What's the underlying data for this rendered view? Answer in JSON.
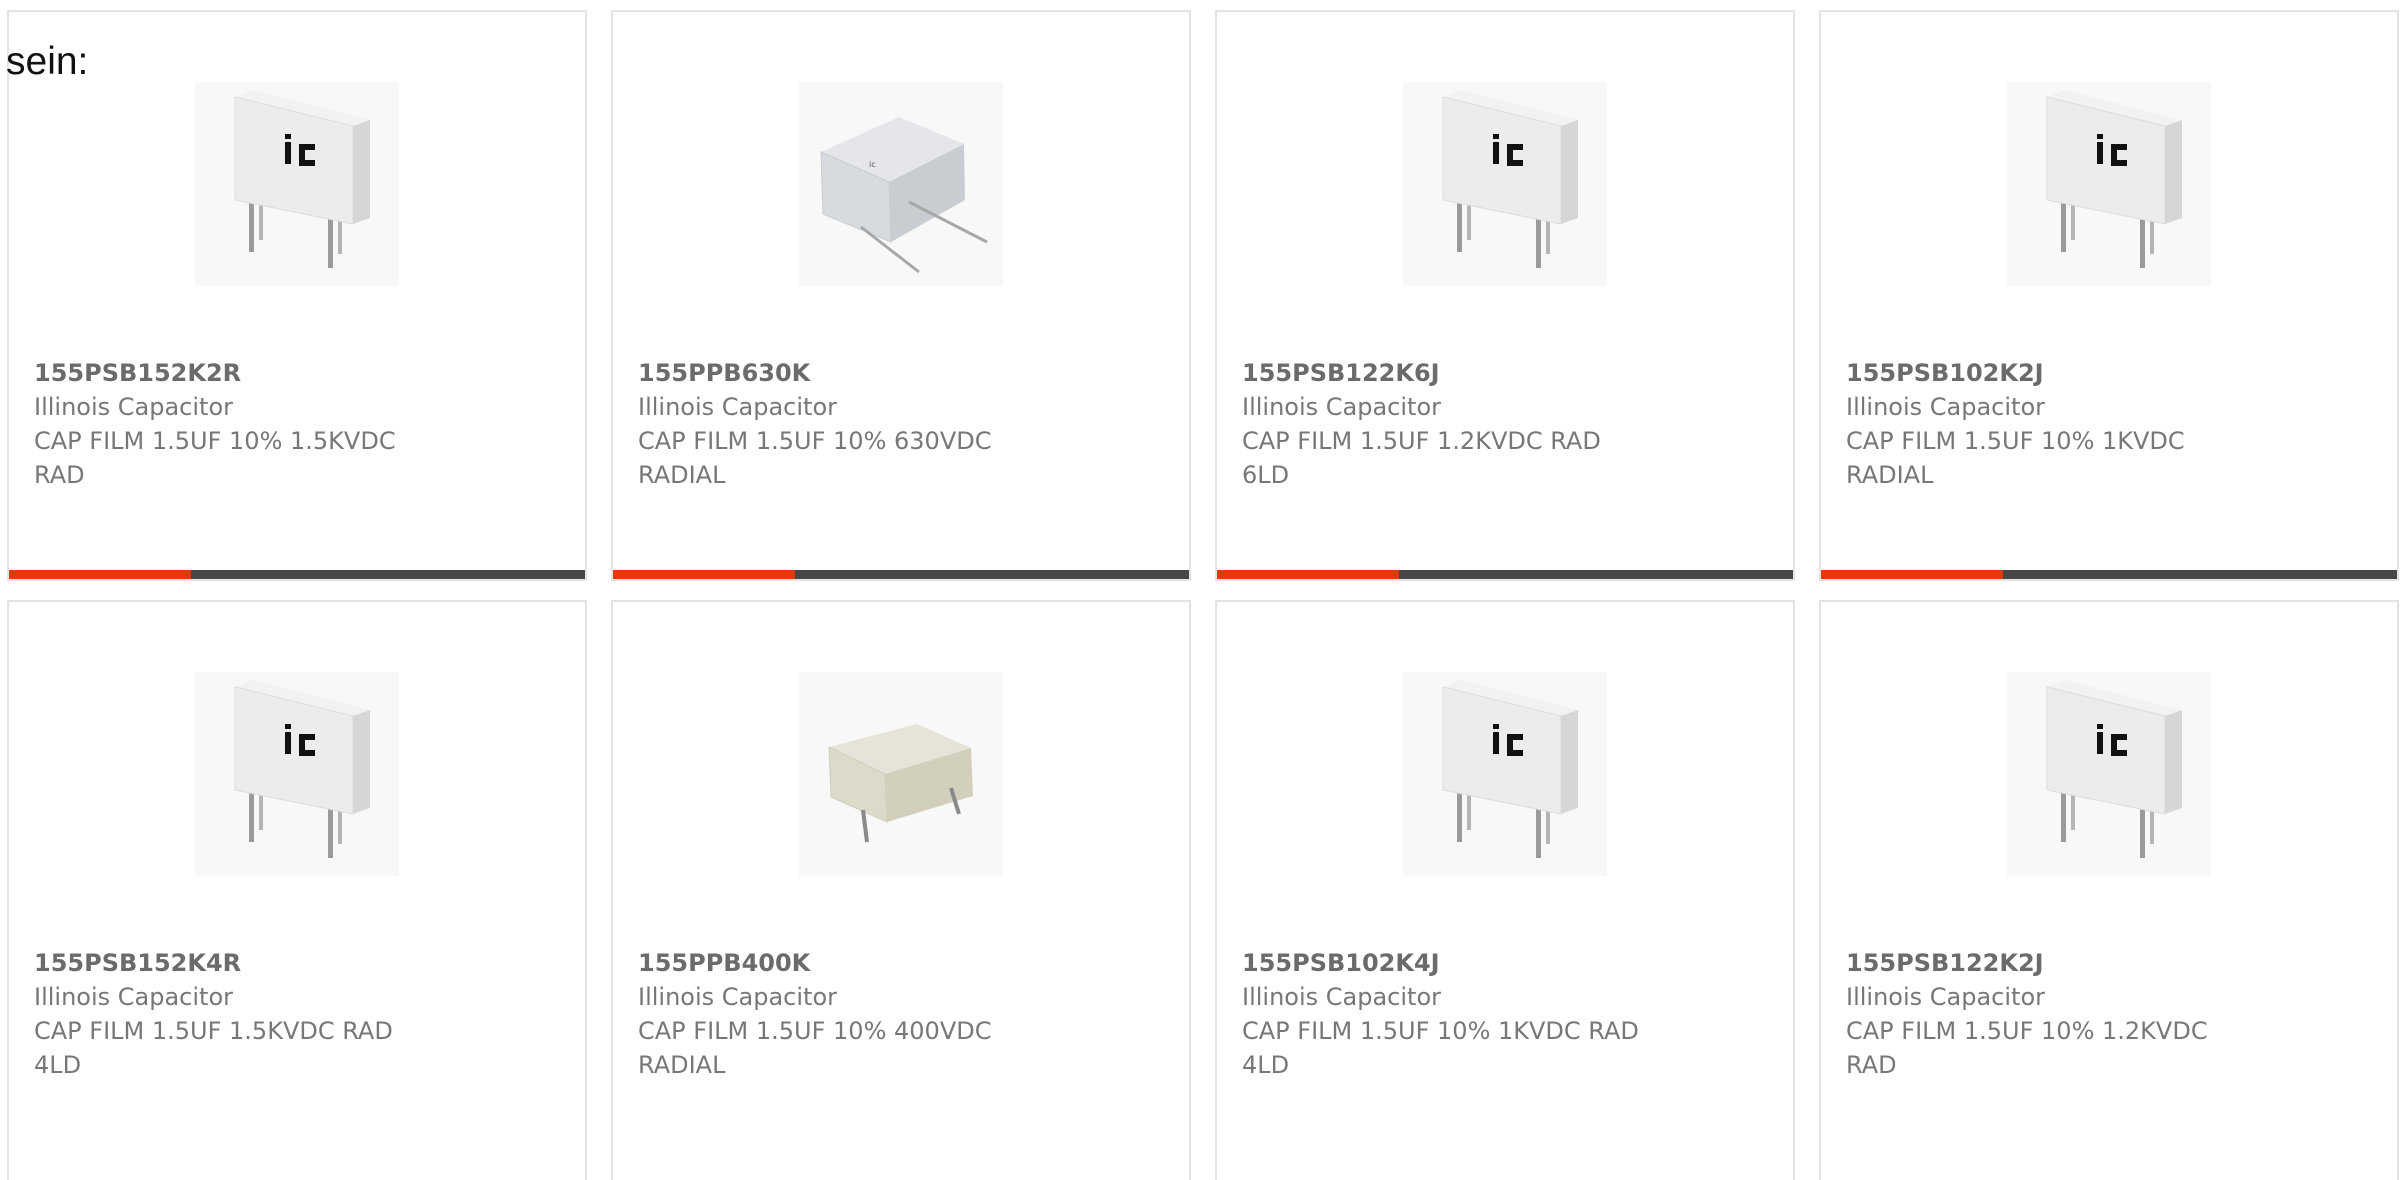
{
  "page": {
    "label": "sein:"
  },
  "colors": {
    "accent": "#e23a07",
    "bar": "#474747",
    "text": "#777777",
    "part_number": "#6b6b6b"
  },
  "products": [
    {
      "part_number": "155PSB152K2R",
      "manufacturer": "Illinois Capacitor",
      "description": "CAP FILM 1.5UF 10% 1.5KVDC\nRAD",
      "image": "ic-box-film-capacitor"
    },
    {
      "part_number": "155PPB630K",
      "manufacturer": "Illinois Capacitor",
      "description": "CAP FILM 1.5UF 10% 630VDC\nRADIAL",
      "image": "grey-box-film-capacitor"
    },
    {
      "part_number": "155PSB122K6J",
      "manufacturer": "Illinois Capacitor",
      "description": "CAP FILM 1.5UF 1.2KVDC RAD\n6LD",
      "image": "ic-box-film-capacitor"
    },
    {
      "part_number": "155PSB102K2J",
      "manufacturer": "Illinois Capacitor",
      "description": "CAP FILM 1.5UF 10% 1KVDC\nRADIAL",
      "image": "ic-box-film-capacitor"
    },
    {
      "part_number": "155PSB152K4R",
      "manufacturer": "Illinois Capacitor",
      "description": "CAP FILM 1.5UF 1.5KVDC RAD\n4LD",
      "image": "ic-box-film-capacitor"
    },
    {
      "part_number": "155PPB400K",
      "manufacturer": "Illinois Capacitor",
      "description": "CAP FILM 1.5UF 10% 400VDC\nRADIAL",
      "image": "beige-box-film-capacitor"
    },
    {
      "part_number": "155PSB102K4J",
      "manufacturer": "Illinois Capacitor",
      "description": "CAP FILM 1.5UF 10% 1KVDC RAD\n4LD",
      "image": "ic-box-film-capacitor"
    },
    {
      "part_number": "155PSB122K2J",
      "manufacturer": "Illinois Capacitor",
      "description": "CAP FILM 1.5UF 10% 1.2KVDC\nRAD",
      "image": "ic-box-film-capacitor"
    }
  ]
}
